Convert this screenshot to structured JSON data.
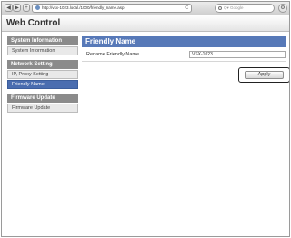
{
  "browser": {
    "back_label": "◀",
    "forward_label": "▶",
    "add_tab_label": "+",
    "url": "http://vsx-1023.local./1000/friendly_name.asp",
    "reload_label": "C",
    "search_placeholder": "Q▾ Google",
    "gear_label": "⚙"
  },
  "header": {
    "title": "Web Control"
  },
  "sidebar": {
    "sections": [
      {
        "heading": "System Information",
        "items": [
          {
            "label": "System Information",
            "active": false
          }
        ]
      },
      {
        "heading": "Network Setting",
        "items": [
          {
            "label": "IP, Proxy Setting",
            "active": false
          },
          {
            "label": "Friendly Name",
            "active": true
          }
        ]
      },
      {
        "heading": "Firmware Update",
        "items": [
          {
            "label": "Firmware Update",
            "active": false
          }
        ]
      }
    ]
  },
  "main": {
    "title": "Friendly Name",
    "field_label": "Rename Friendly Name",
    "field_value": "VSX-1023",
    "apply_label": "Apply"
  },
  "colors": {
    "accent": "#5779b8",
    "active_item": "#4a6db0",
    "section_heading": "#8b8b8b"
  }
}
